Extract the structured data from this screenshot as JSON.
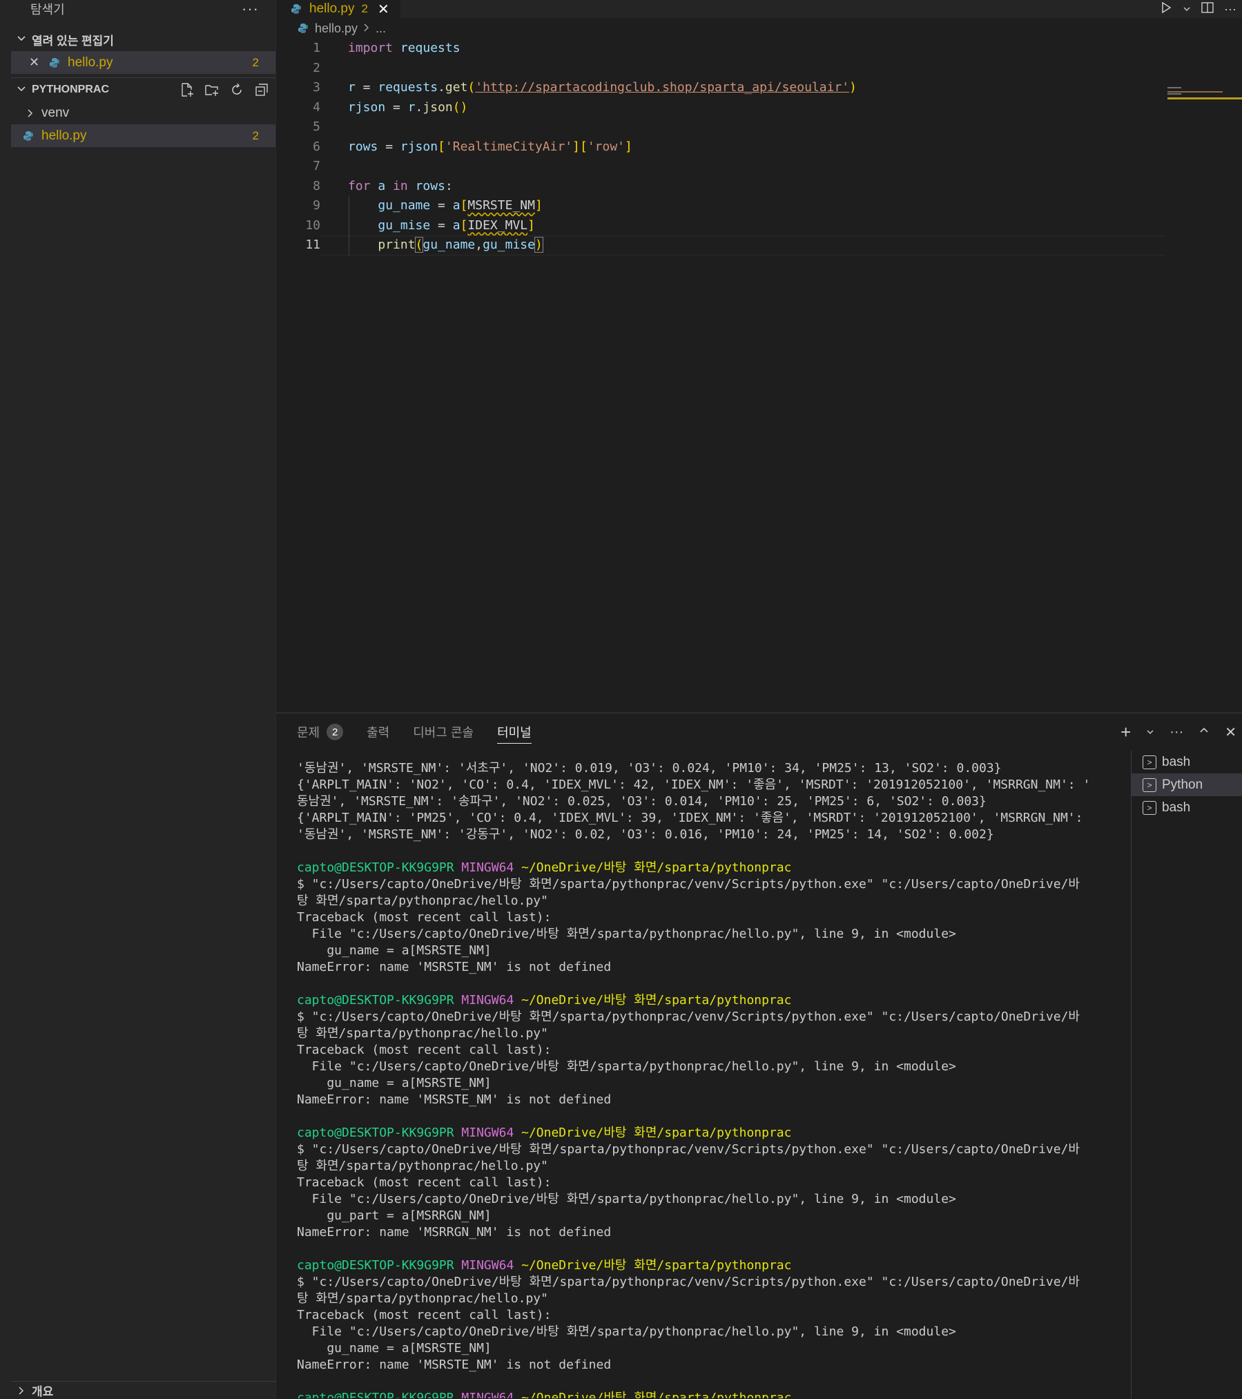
{
  "sidebar": {
    "title": "탐색기",
    "more": "···",
    "open_editors": {
      "label": "열려 있는 편집기",
      "items": [
        {
          "close": "✕",
          "name": "hello.py",
          "badge": "2"
        }
      ]
    },
    "project": {
      "label": "PYTHONPRAC",
      "items": [
        {
          "name": "venv"
        },
        {
          "name": "hello.py",
          "badge": "2"
        }
      ]
    },
    "outline": {
      "label": "개요"
    }
  },
  "editor": {
    "tab": {
      "name": "hello.py",
      "count": "2",
      "close": "✕"
    },
    "breadcrumb": {
      "file": "hello.py",
      "rest": "..."
    },
    "line_numbers": [
      "1",
      "2",
      "3",
      "4",
      "5",
      "6",
      "7",
      "8",
      "9",
      "10",
      "11"
    ],
    "code": {
      "l1": {
        "kw": "import",
        "mod": "requests"
      },
      "l3": {
        "var": "r",
        "eq": " = ",
        "obj": "requests",
        "dot": ".",
        "fn": "get",
        "open": "(",
        "url": "'http://spartacodingclub.shop/sparta_api/seoulair'",
        "close": ")"
      },
      "l4": {
        "var": "rjson",
        "eq": " = ",
        "obj": "r",
        "dot": ".",
        "fn": "json",
        "paren": "()"
      },
      "l6": {
        "var": "rows",
        "eq": " = ",
        "obj": "rjson",
        "o1": "[",
        "k1": "'RealtimeCityAir'",
        "c1": "]",
        "o2": "[",
        "k2": "'row'",
        "c2": "]"
      },
      "l8": {
        "kw1": "for",
        "sp1": " ",
        "var": "a",
        "sp2": " ",
        "kw2": "in",
        "sp3": " ",
        "rows": "rows",
        "colon": ":"
      },
      "l9": {
        "indent": "    ",
        "var": "gu_name",
        "eq": " = ",
        "obj": "a",
        "open": "[",
        "name": "MSRSTE_NM",
        "close": "]"
      },
      "l10": {
        "indent": "    ",
        "var": "gu_mise",
        "eq": " = ",
        "obj": "a",
        "open": "[",
        "name": "IDEX_MVL",
        "close": "]"
      },
      "l11": {
        "indent": "    ",
        "fn": "print",
        "open": "(",
        "a1": "gu_name",
        "comma": ",",
        "a2": "gu_mise",
        "close": ")"
      }
    }
  },
  "panel": {
    "tabs": [
      {
        "label": "문제",
        "count": "2"
      },
      {
        "label": "출력"
      },
      {
        "label": "디버그 콘솔"
      },
      {
        "label": "터미널"
      }
    ],
    "actions": {
      "add": "+",
      "dropdown": "⌄",
      "more": "···",
      "maximize": "^",
      "close": "✕"
    },
    "terminals": [
      {
        "label": "bash"
      },
      {
        "label": "Python"
      },
      {
        "label": "bash"
      }
    ],
    "output": {
      "pre": [
        "'동남권', 'MSRSTE_NM': '서초구', 'NO2': 0.019, 'O3': 0.024, 'PM10': 34, 'PM25': 13, 'SO2': 0.003}",
        "{'ARPLT_MAIN': 'NO2', 'CO': 0.4, 'IDEX_MVL': 42, 'IDEX_NM': '좋음', 'MSRDT': '201912052100', 'MSRRGN_NM': '",
        "동남권', 'MSRSTE_NM': '송파구', 'NO2': 0.025, 'O3': 0.014, 'PM10': 25, 'PM25': 6, 'SO2': 0.003}",
        "{'ARPLT_MAIN': 'PM25', 'CO': 0.4, 'IDEX_MVL': 39, 'IDEX_NM': '좋음', 'MSRDT': '201912052100', 'MSRRGN_NM':",
        "'동남권', 'MSRSTE_NM': '강동구', 'NO2': 0.02, 'O3': 0.016, 'PM10': 24, 'PM25': 14, 'SO2': 0.002}"
      ],
      "prompt": {
        "user": "capto@DESKTOP-KK9G9PR",
        "shell": "MINGW64",
        "path": "~/OneDrive/바탕 화면/sparta/pythonprac"
      },
      "runs": [
        {
          "cmd1": "$ \"c:/Users/capto/OneDrive/바탕 화면/sparta/pythonprac/venv/Scripts/python.exe\" \"c:/Users/capto/OneDrive/바",
          "cmd2": "탕 화면/sparta/pythonprac/hello.py\"",
          "tb": "Traceback (most recent call last):",
          "file": "  File \"c:/Users/capto/OneDrive/바탕 화면/sparta/pythonprac/hello.py\", line 9, in <module>",
          "src": "    gu_name = a[MSRSTE_NM]",
          "err": "NameError: name 'MSRSTE_NM' is not defined"
        },
        {
          "cmd1": "$ \"c:/Users/capto/OneDrive/바탕 화면/sparta/pythonprac/venv/Scripts/python.exe\" \"c:/Users/capto/OneDrive/바",
          "cmd2": "탕 화면/sparta/pythonprac/hello.py\"",
          "tb": "Traceback (most recent call last):",
          "file": "  File \"c:/Users/capto/OneDrive/바탕 화면/sparta/pythonprac/hello.py\", line 9, in <module>",
          "src": "    gu_name = a[MSRSTE_NM]",
          "err": "NameError: name 'MSRSTE_NM' is not defined"
        },
        {
          "cmd1": "$ \"c:/Users/capto/OneDrive/바탕 화면/sparta/pythonprac/venv/Scripts/python.exe\" \"c:/Users/capto/OneDrive/바",
          "cmd2": "탕 화면/sparta/pythonprac/hello.py\"",
          "tb": "Traceback (most recent call last):",
          "file": "  File \"c:/Users/capto/OneDrive/바탕 화면/sparta/pythonprac/hello.py\", line 9, in <module>",
          "src": "    gu_part = a[MSRRGN_NM]",
          "err": "NameError: name 'MSRRGN_NM' is not defined"
        },
        {
          "cmd1": "$ \"c:/Users/capto/OneDrive/바탕 화면/sparta/pythonprac/venv/Scripts/python.exe\" \"c:/Users/capto/OneDrive/바",
          "cmd2": "탕 화면/sparta/pythonprac/hello.py\"",
          "tb": "Traceback (most recent call last):",
          "file": "  File \"c:/Users/capto/OneDrive/바탕 화면/sparta/pythonprac/hello.py\", line 9, in <module>",
          "src": "    gu_name = a[MSRSTE_NM]",
          "err": "NameError: name 'MSRSTE_NM' is not defined"
        }
      ]
    }
  },
  "colors": {
    "warning": "#cca700",
    "prompt_user": "#23d18b",
    "prompt_shell": "#d670d6",
    "prompt_path": "#e5e510"
  }
}
